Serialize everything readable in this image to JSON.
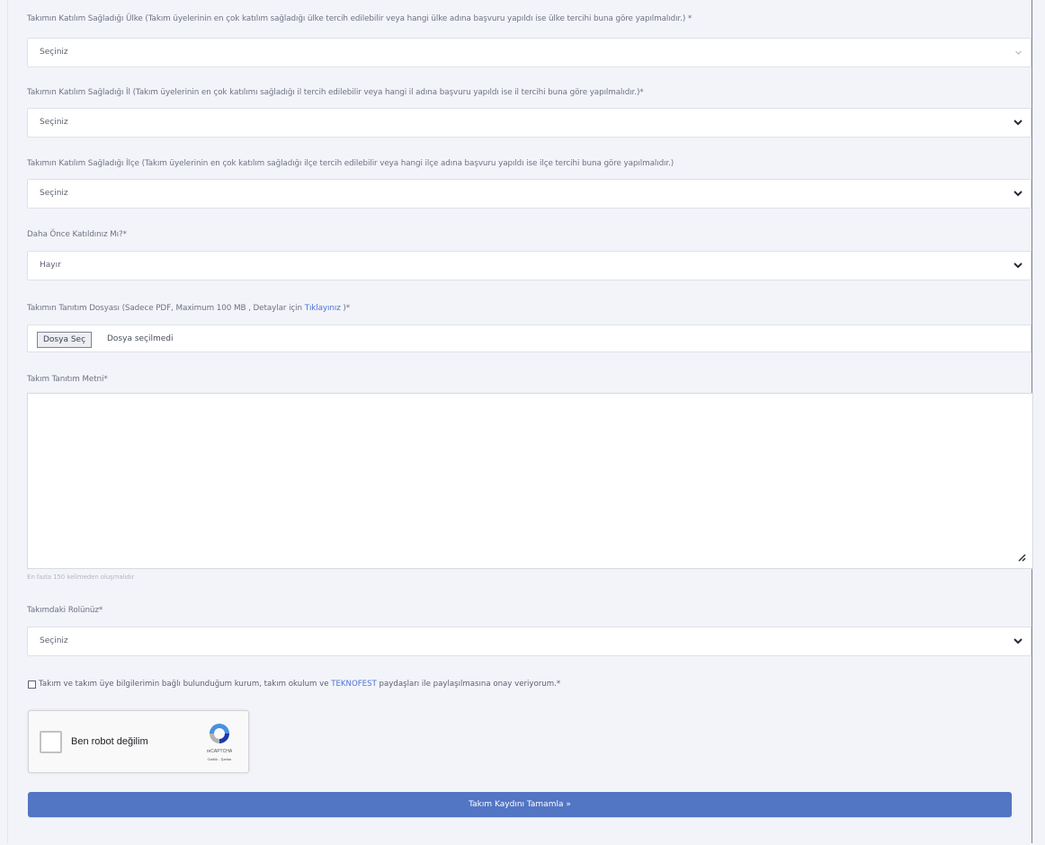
{
  "form": {
    "country": {
      "label": "Takımın Katılım Sağladığı Ülke (Takım üyelerinin en çok katılım sağladığı ülke tercih edilebilir veya hangi ülke adına başvuru yapıldı ise ülke tercihi buna göre yapılmalıdır.) *",
      "value": "Seçiniz",
      "icon": "chevron-down-icon"
    },
    "province": {
      "label": "Takımın Katılım Sağladığı İl (Takım üyelerinin en çok katılımı sağladığı il tercih edilebilir veya hangi il adına başvuru yapıldı ise il tercihi buna göre yapılmalıdır.)*",
      "value": "Seçiniz",
      "icon": "chevron-down-icon"
    },
    "district": {
      "label": "Takımın Katılım Sağladığı İlçe (Takım üyelerinin en çok katılım sağladığı ilçe tercih edilebilir veya hangi ilçe adına başvuru yapıldı ise ilçe tercihi buna göre yapılmalıdır.)",
      "value": "Seçiniz",
      "icon": "chevron-down-icon"
    },
    "previous_participation": {
      "label": "Daha Önce Katıldınız Mı?*",
      "value": "Hayır",
      "icon": "chevron-down-icon"
    },
    "description_file": {
      "label_prefix": "Takımın Tanıtım Dosyası (Sadece PDF, Maximum 100 MB , Detaylar için ",
      "label_link": "Tıklayınız",
      "label_suffix": " )*",
      "button_label": "Dosya Seç",
      "status": "Dosya seçilmedi"
    },
    "description_text": {
      "label": "Takım Tanıtım Metni*",
      "value": "",
      "helper": "En fazla 150 kelimeden oluşmalıdır",
      "resize_icon": "resize-handle-icon"
    },
    "team_role": {
      "label": "Takımdaki Rolünüz*",
      "value": "Seçiniz",
      "icon": "chevron-down-icon"
    },
    "consent": {
      "prefix": "Takım ve takım üye bilgilerimin bağlı bulunduğum kurum, takım okulum ve ",
      "highlight": "TEKNOFEST",
      "suffix": " paydaşları ile paylaşılmasına onay veriyorum.*",
      "checked": false
    },
    "captcha": {
      "label": "Ben robot değilim",
      "brand": "reCAPTCHA",
      "links": "Gizlilik - Şartlar",
      "logo_icon": "recaptcha-logo-icon"
    },
    "submit_label": "Takım Kaydını Tamamla »"
  },
  "colors": {
    "page_bg": "#f3f4f9",
    "button_bg": "#5275c4",
    "link": "#4a73d8"
  }
}
